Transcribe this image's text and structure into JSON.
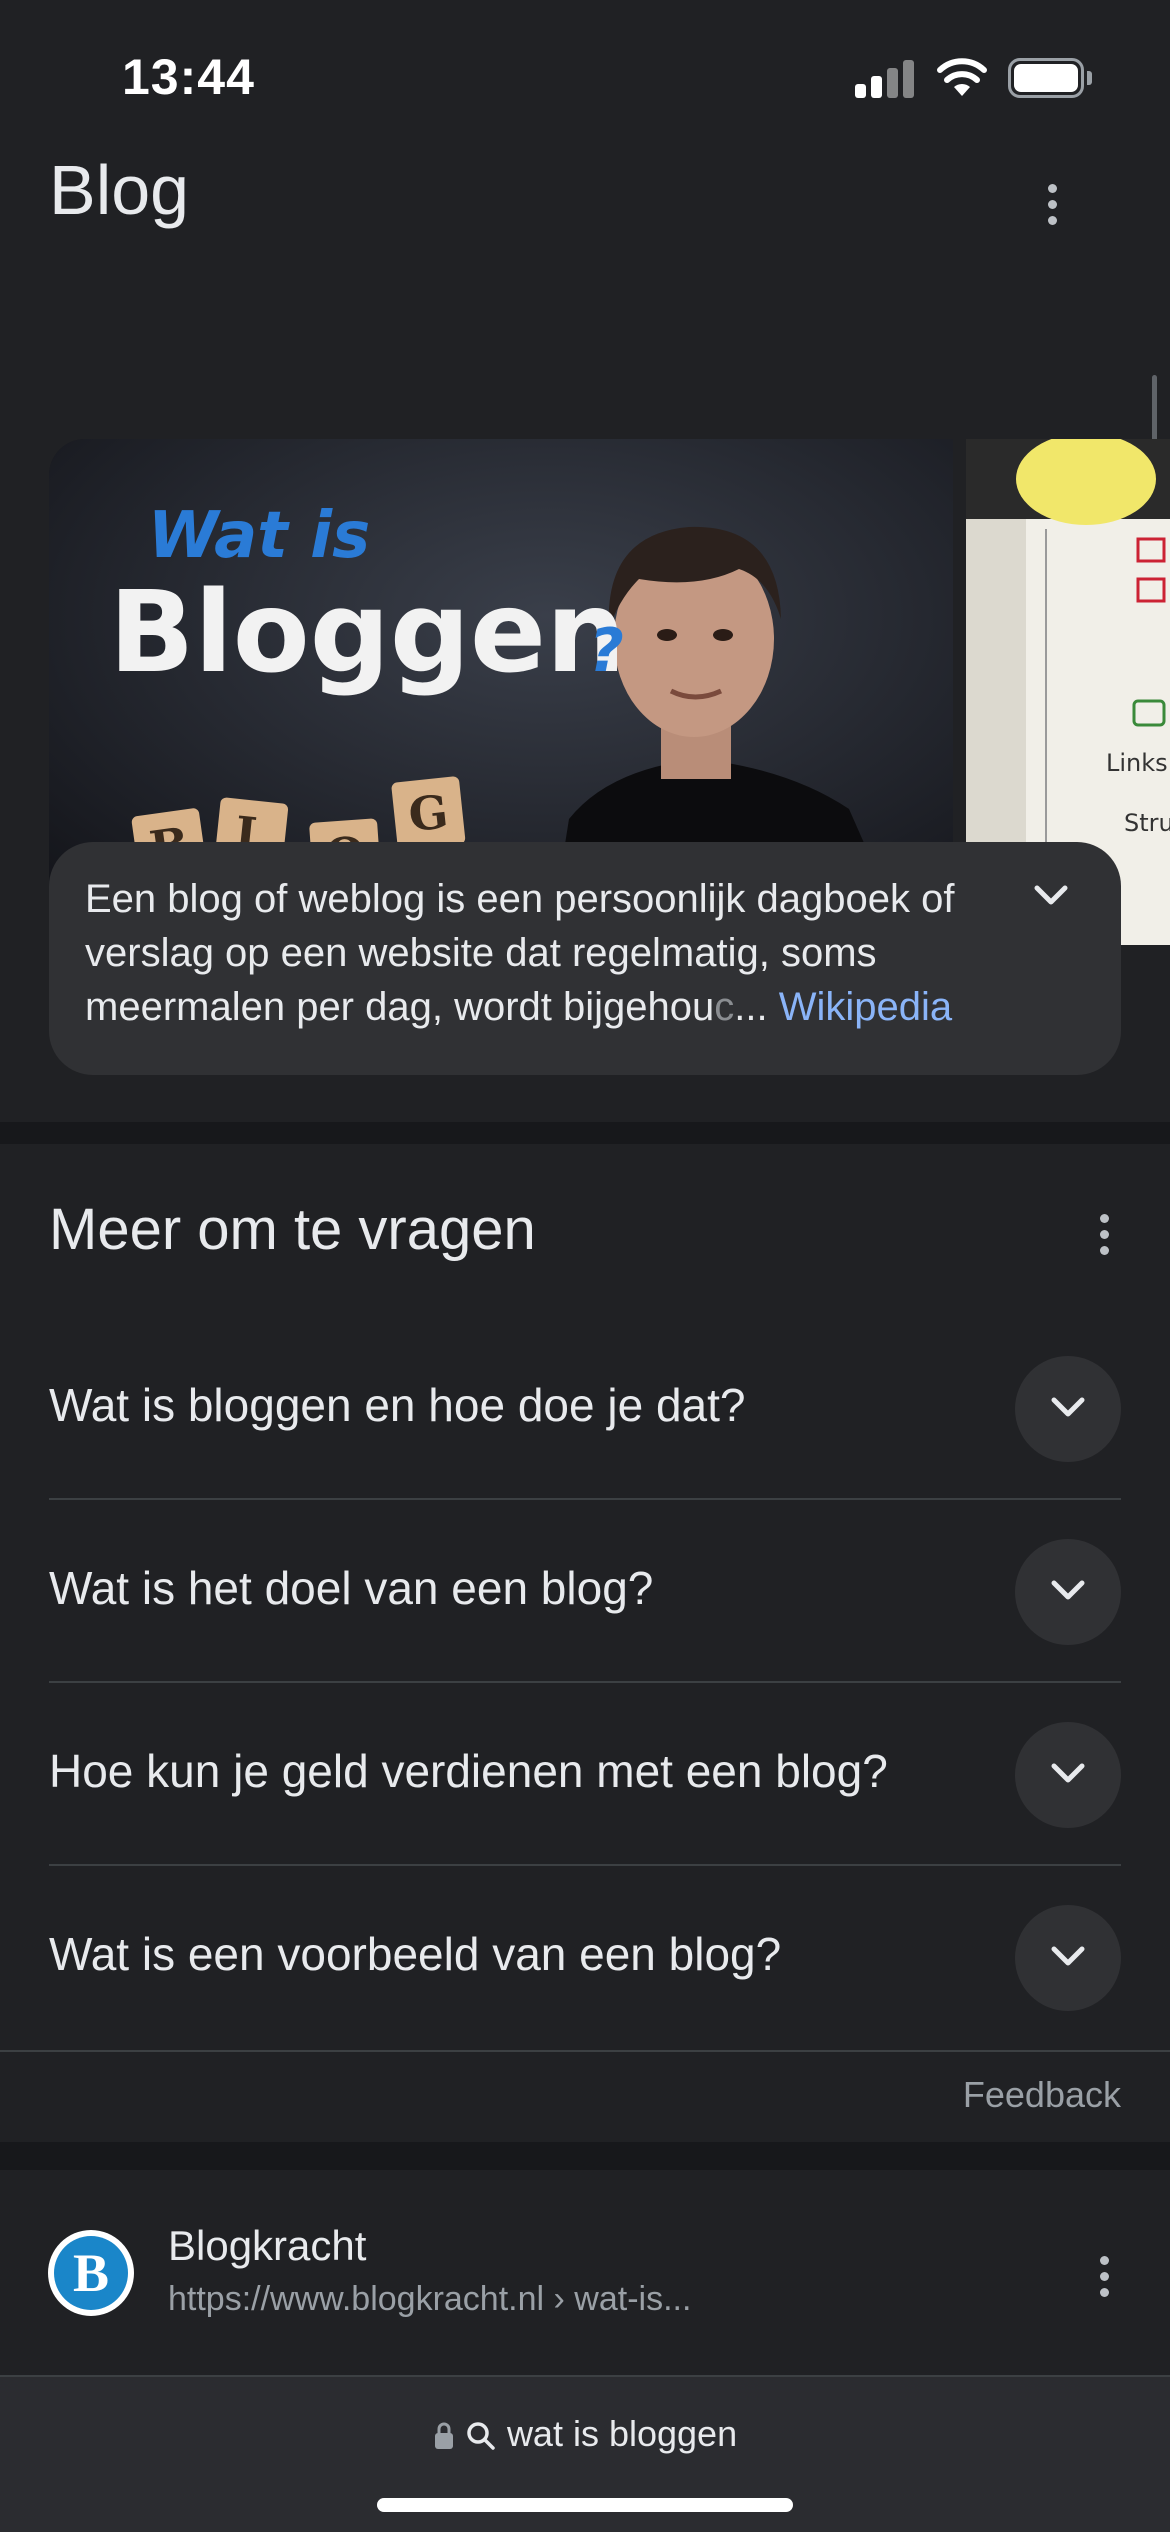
{
  "status_bar": {
    "time": "13:44"
  },
  "knowledge_panel": {
    "title": "Blog",
    "snippet": {
      "text": "Een blog of weblog is een persoonlijk dagboek of verslag op een website dat regelmatig, soms meermalen per dag, wordt bijgehou",
      "faded": "c",
      "ellipsis": "...",
      "source": "Wikipedia"
    },
    "hero_image": {
      "line1": "Wat is",
      "line2": "Bloggen",
      "mark": "?",
      "tiles": [
        "B",
        "L",
        "O",
        "G"
      ]
    },
    "side_image": {
      "labels": [
        "Links",
        "Stru"
      ]
    }
  },
  "people_also_ask": {
    "title": "Meer om te vragen",
    "questions": [
      "Wat is bloggen en hoe doe je dat?",
      "Wat is het doel van een blog?",
      "Hoe kun je geld verdienen met een blog?",
      "Wat is een voorbeeld van een blog?"
    ],
    "feedback": "Feedback"
  },
  "result": {
    "favicon_letter": "B",
    "site_name": "Blogkracht",
    "url": "https://www.blogkracht.nl",
    "path": "› wat-is..."
  },
  "address_bar": {
    "query": "wat is bloggen"
  },
  "colors": {
    "background": "#202124",
    "card": "#303134",
    "link": "#8ab4f8",
    "favicon": "#1a86c9"
  }
}
